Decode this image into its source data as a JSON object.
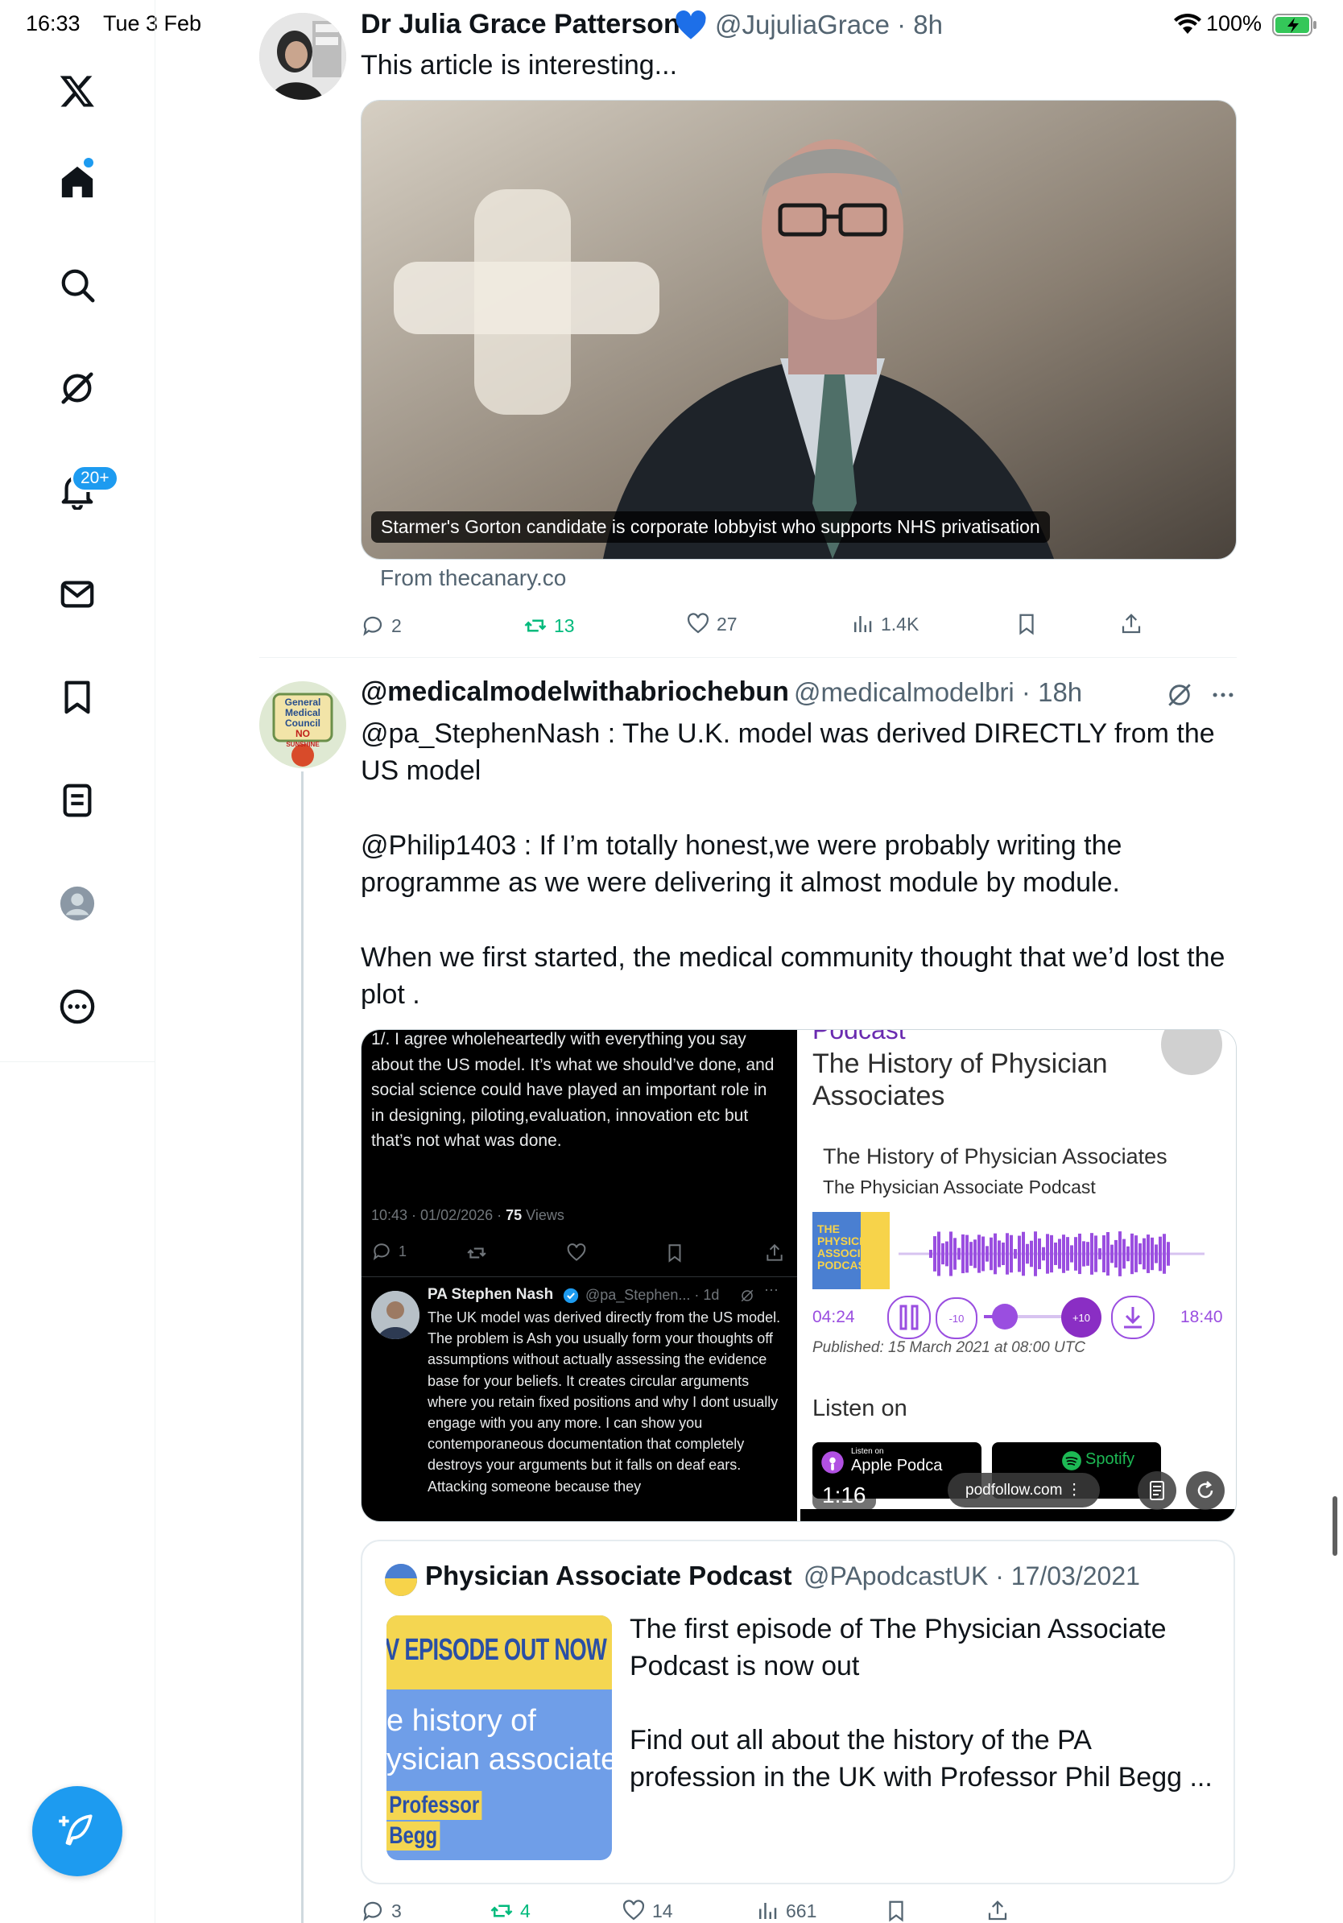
{
  "status_bar": {
    "time": "16:33",
    "date": "Tue 3 Feb",
    "battery": "100%"
  },
  "nav": {
    "icons": [
      "x-logo-icon",
      "home-icon",
      "search-icon",
      "grok-icon",
      "notifications-icon",
      "messages-icon",
      "bookmarks-icon",
      "lists-icon",
      "profile-icon",
      "more-icon"
    ],
    "notification_badge": "20+"
  },
  "tweet1": {
    "name": "Dr Julia Grace Patterson",
    "handle_time": "@JujuliaGrace · 8h",
    "text": "This article is interesting...",
    "card_caption": "Starmer's Gorton candidate is corporate lobbyist who supports NHS privatisation",
    "card_source": "From thecanary.co",
    "replies": "2",
    "retweets": "13",
    "likes": "27",
    "views": "1.4K"
  },
  "tweet2": {
    "name": "@medicalmodelwithabriochebun",
    "handle_time": "@medicalmodelbri · 18h",
    "avatar_text": [
      "General",
      "Medical",
      "Council",
      "NO",
      "SUNSHINE"
    ],
    "para1": "@pa_StephenNash : The U.K. model was derived DIRECTLY from the US model",
    "para2": "@Philip1403 : If I’m totally honest,we were probably writing the programme as we were delivering it almost module by module.",
    "para3": "When we first started, the medical community thought that we’d lost the plot .",
    "shot1": {
      "top_text": "1/. I agree wholeheartedly with everything you say about the US model. It’s what we should’ve done, and social science could have played an important role in in designing, piloting,evaluation, innovation etc but that’s not what was done.",
      "meta_time": "10:43 · 01/02/2026 · ",
      "meta_views_num": "75",
      "meta_views_label": " Views",
      "reply_count": "1",
      "reply_name": "PA Stephen Nash",
      "reply_handle": "@pa_Stephen... · 1d",
      "reply_text": "The UK model was derived directly from the US model. The problem is Ash you usually form your thoughts off assumptions without actually assessing the evidence base for your beliefs. It creates circular arguments where you retain fixed positions and why I dont usually engage with you any more. I can show you contemporaneous documentation that completely destroys your arguments but it falls on deaf ears. Attacking someone because they"
    },
    "shot2": {
      "top_cut": "Podcast",
      "title": "The History of Physician Associates",
      "ep_title": "The History of Physician Associates",
      "ep_show": "The Physician Associate Podcast",
      "cover_text": "THE PHYSICIAN ASSOCIATE PODCAST",
      "elapsed": "04:24",
      "duration": "18:40",
      "published": "Published: 15 March 2021 at 08:00 UTC",
      "listen_on": "Listen on",
      "apple_small": "Listen on",
      "apple": "Apple Podca",
      "spotify": "Spotify",
      "video_time": "1:16",
      "pill": "podfollow.com ⋮"
    },
    "quote": {
      "name": "Physician Associate Podcast",
      "handle_time": "@PApodcastUK · 17/03/2021",
      "thumb_line1": "V EPISODE OUT NOW",
      "thumb_line2": "e history of",
      "thumb_line3": "ysician associate",
      "thumb_line4": "Professor",
      "thumb_line5": "Begg",
      "text1": "The first episode of The Physician Associate Podcast is now out",
      "text2": "Find out all about the history of the PA profession in the UK with Professor Phil Begg ..."
    },
    "replies": "3",
    "retweets": "4",
    "likes": "14",
    "views": "661"
  }
}
